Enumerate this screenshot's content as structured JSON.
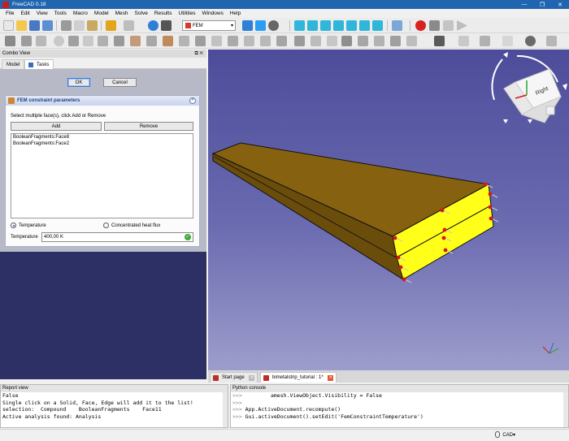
{
  "window": {
    "title": "FreeCAD 0.18",
    "minimize": "—",
    "restore": "❐",
    "close": "✕"
  },
  "menu": [
    "File",
    "Edit",
    "View",
    "Tools",
    "Macro",
    "Model",
    "Mesh",
    "Solve",
    "Results",
    "Utilities",
    "Windows",
    "Help"
  ],
  "workbench": {
    "selected": "FEM"
  },
  "combo_view": {
    "title": "Combo View",
    "tabs": [
      {
        "label": "Model"
      },
      {
        "label": "Tasks"
      }
    ],
    "ok_label": "OK",
    "cancel_label": "Cancel"
  },
  "constraint": {
    "header": "FEM constraint parameters",
    "collapse": "^",
    "instruction": "Select multiple face(s), click Add or Remove",
    "add_label": "Add",
    "remove_label": "Remove",
    "faces": [
      "BooleanFragments:Face8",
      "BooleanFragments:Face2"
    ],
    "radio_temperature": "Temperature",
    "radio_flux": "Concentrated heat flux",
    "temperature_label": "Temperature",
    "temperature_value": "400,00 K",
    "selected_mode": "Temperature"
  },
  "navcube": {
    "face_label": "Right"
  },
  "doc_tabs": [
    {
      "label": "Start page"
    },
    {
      "label": "bimetalstrip_tutorial : 1*"
    }
  ],
  "report_view": {
    "title": "Report view",
    "lines": [
      "False",
      "Single click on a Solid, Face, Edge will add it to the list!",
      "selection:  Compound    BooleanFragments    Face11",
      "Active analysis found: Analysis"
    ]
  },
  "python_console": {
    "title": "Python console",
    "prompt": ">>>",
    "lines": [
      "        amesh.ViewObject.Visibility = False",
      "",
      "App.ActiveDocument.recompute()",
      "Gui.activeDocument().setEdit('FemConstraintTemperature')"
    ]
  },
  "status": {
    "nav_style": "CAD▾"
  },
  "colors": {
    "titlebar": "#1f65b0",
    "viewport_top": "#4c4c9a",
    "viewport_bottom": "#9d9dcc",
    "beam": "#8a6410",
    "selected_face": "#ffff1a",
    "constraint_marker": "#d61818"
  }
}
